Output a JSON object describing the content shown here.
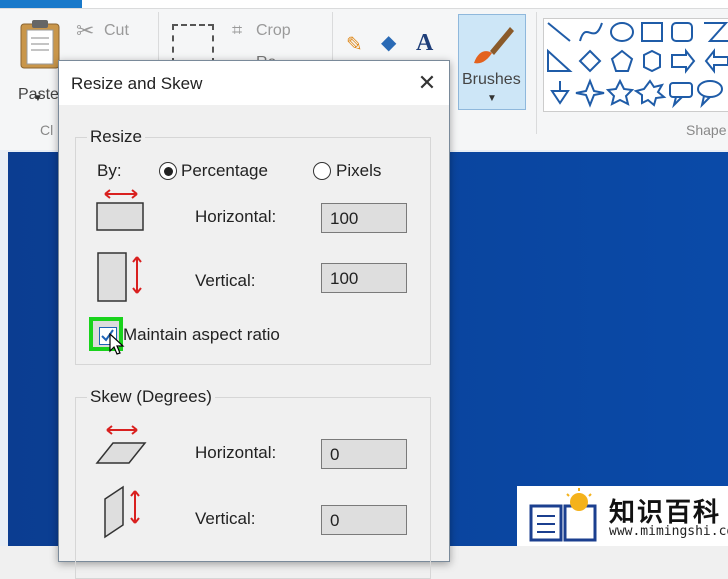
{
  "ribbon": {
    "clipboard": {
      "paste_label": "Paste",
      "cut_label": "Cut",
      "group_label": "Cl"
    },
    "image": {
      "crop_label": "Crop",
      "resize_partial": "Re"
    },
    "brushes_label": "Brushes",
    "shapes_group_label": "Shape"
  },
  "dialog": {
    "title": "Resize and Skew",
    "resize": {
      "group_label": "Resize",
      "by_label": "By:",
      "percentage_label": "Percentage",
      "pixels_label": "Pixels",
      "horizontal_label": "Horizontal:",
      "horizontal_value": "100",
      "vertical_label": "Vertical:",
      "vertical_value": "100",
      "maintain_label": "Maintain aspect ratio"
    },
    "skew": {
      "group_label": "Skew (Degrees)",
      "horizontal_label": "Horizontal:",
      "horizontal_value": "0",
      "vertical_label": "Vertical:",
      "vertical_value": "0"
    }
  },
  "watermark": {
    "title": "知识百科",
    "url": "www.mimingshi.com"
  },
  "colors": {
    "accent": "#1979ca",
    "highlight": "#19d31c",
    "canvas_blue": "#0b3d91",
    "arrow_red": "#d9201f"
  }
}
